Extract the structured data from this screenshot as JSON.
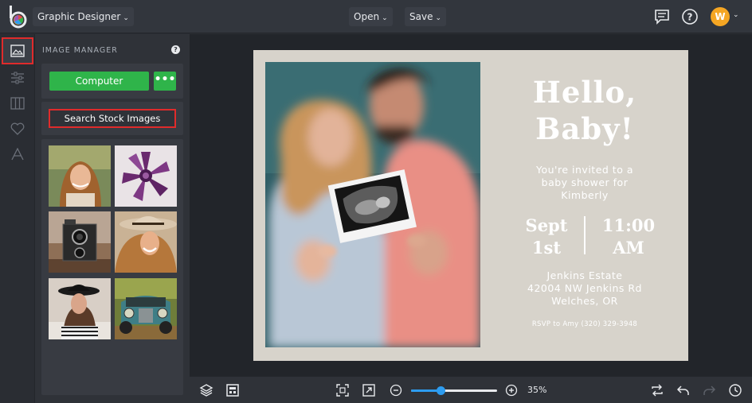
{
  "header": {
    "app_mode": "Graphic Designer",
    "open_label": "Open",
    "save_label": "Save",
    "avatar_initial": "W"
  },
  "rail": {
    "items": [
      "image-manager",
      "adjustments",
      "layouts",
      "favorites",
      "text"
    ],
    "active": "image-manager"
  },
  "panel": {
    "title": "IMAGE MANAGER",
    "help": "?",
    "computer_label": "Computer",
    "more_label": "•••",
    "stock_label": "Search Stock Images",
    "thumbnails": [
      "woman-smiling",
      "purple-succulent",
      "vintage-camera",
      "woman-hat-laughing",
      "woman-black-hat",
      "vintage-truck"
    ]
  },
  "card": {
    "hello_line1": "Hello,",
    "hello_line2": "Baby!",
    "invite_line1": "You're invited to a",
    "invite_line2": "baby shower for",
    "invite_line3": "Kimberly",
    "date_line1": "Sept",
    "date_line2": "1st",
    "time_line1": "11:00",
    "time_line2": "AM",
    "venue_line1": "Jenkins Estate",
    "venue_line2": "42004 NW Jenkins Rd",
    "venue_line3": "Welches, OR",
    "rsvp": "RSVP to Amy (320) 329-3948"
  },
  "bottom": {
    "zoom_label": "35%",
    "zoom_value": 0.35,
    "zoom_minus": "−",
    "zoom_plus": "+"
  },
  "colors": {
    "accent_green": "#2fb44a",
    "highlight_red": "#e02b2b",
    "zoom_blue": "#2d9cf0",
    "avatar_orange": "#f5a623"
  }
}
